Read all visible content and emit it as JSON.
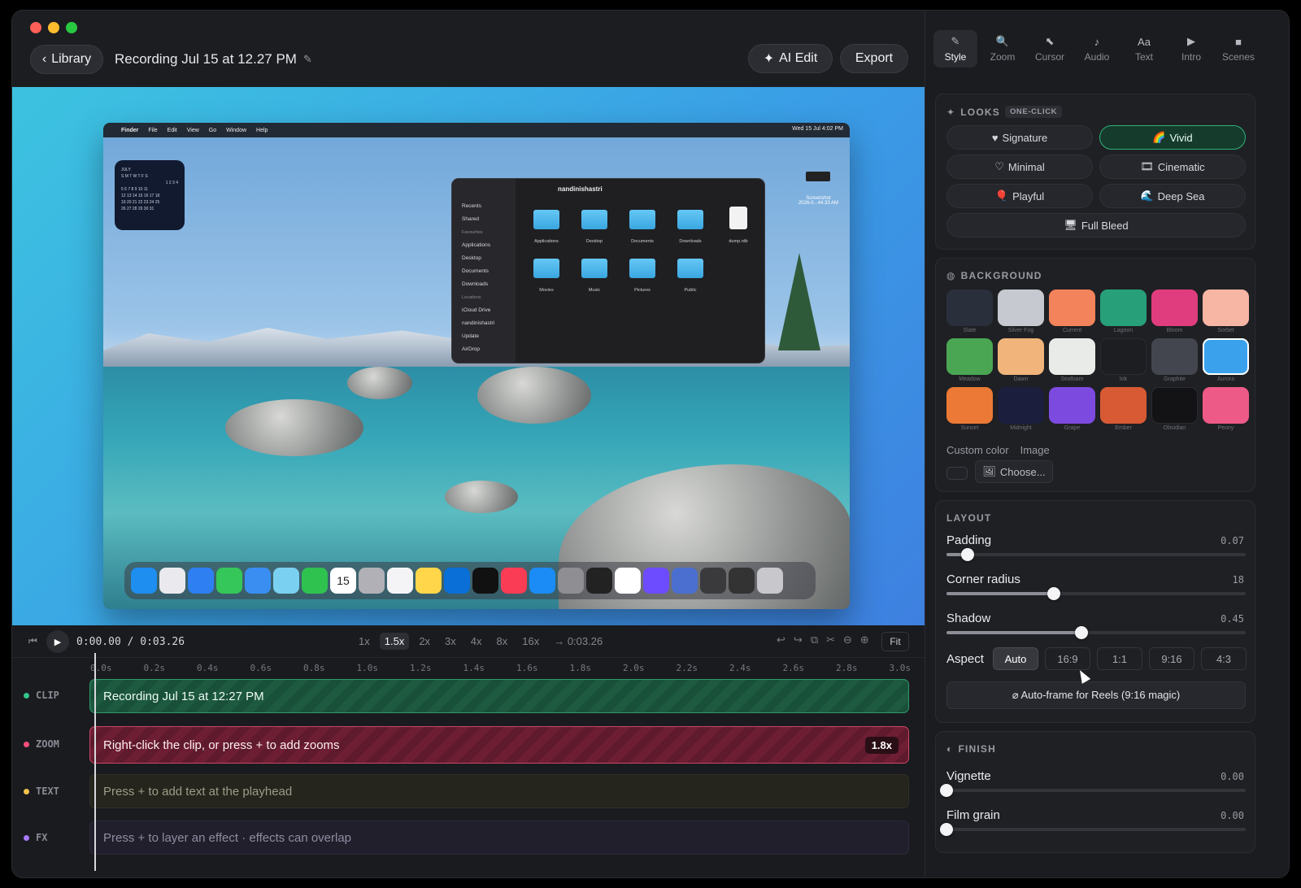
{
  "header": {
    "library_label": "Library",
    "recording_title": "Recording Jul 15 at 12.27 PM",
    "ai_edit_label": "AI Edit",
    "export_label": "Export"
  },
  "preview": {
    "menubar": {
      "app": "Finder",
      "menus": [
        "File",
        "Edit",
        "View",
        "Go",
        "Window",
        "Help"
      ],
      "clock": "Wed 15 Jul 4:02 PM"
    },
    "calendar": {
      "month": "JULY",
      "weekdays": "S M T W T F S",
      "rows": [
        "1 2 3 4",
        "5 6 7 8 9 10 11",
        "12 13 14 15 16 17 18",
        "19 20 21 22 23 24 25",
        "26 27 28 29 30 31"
      ]
    },
    "finder": {
      "title": "nandinishastri",
      "sidebar": [
        "Recents",
        "Shared",
        "Favourites",
        "Applications",
        "Desktop",
        "Documents",
        "Downloads",
        "Locations",
        "iCloud Drive",
        "nandinishastri",
        "Update",
        "AirDrop"
      ],
      "folders": [
        "Applications",
        "Desktop",
        "Documents",
        "Downloads",
        "dump.rdb",
        "Movies",
        "Music",
        "Pictures",
        "Public"
      ]
    },
    "screenshot_label": "Screenshot\n2026-0...44.33 AM",
    "dock_calendar_day": "15"
  },
  "transport": {
    "time": "0:00.00 / 0:03.26",
    "speeds": [
      "1x",
      "1.5x",
      "2x",
      "3x",
      "4x",
      "8x",
      "16x",
      "→ 0:03.26"
    ],
    "active_speed": "1.5x",
    "fit_label": "Fit"
  },
  "timeline": {
    "ticks": [
      "0.0s",
      "0.2s",
      "0.4s",
      "0.6s",
      "0.8s",
      "1.0s",
      "1.2s",
      "1.4s",
      "1.6s",
      "1.8s",
      "2.0s",
      "2.2s",
      "2.4s",
      "2.6s",
      "2.8s",
      "3.0s"
    ],
    "tracks": {
      "clip": {
        "label": "CLIP",
        "text": "Recording Jul 15 at 12:27 PM",
        "color": "#34c58a"
      },
      "zoom": {
        "label": "ZOOM",
        "text": "Right-click the clip, or press + to add zooms",
        "badge": "1.8x",
        "color": "#ff4f7b"
      },
      "text": {
        "label": "TEXT",
        "text": "Press + to add text at the playhead",
        "color": "#f2c34b"
      },
      "fx": {
        "label": "FX",
        "text": "Press + to layer an effect · effects can overlap",
        "color": "#a979ff"
      }
    }
  },
  "panel": {
    "tabs": [
      {
        "label": "Style",
        "icon": "brush-icon",
        "glyph": "✎"
      },
      {
        "label": "Zoom",
        "icon": "magnifier-icon",
        "glyph": "🔍"
      },
      {
        "label": "Cursor",
        "icon": "cursor-icon",
        "glyph": "⬉"
      },
      {
        "label": "Audio",
        "icon": "note-icon",
        "glyph": "♪"
      },
      {
        "label": "Text",
        "icon": "text-icon",
        "glyph": "Aa"
      },
      {
        "label": "Intro",
        "icon": "play-icon",
        "glyph": "▶"
      },
      {
        "label": "Scenes",
        "icon": "square-icon",
        "glyph": "■"
      }
    ],
    "looks": {
      "title": "LOOKS",
      "tag": "ONE-CLICK",
      "items": [
        {
          "label": "Signature",
          "glyph": "♥"
        },
        {
          "label": "Vivid",
          "glyph": "🌈"
        },
        {
          "label": "Minimal",
          "glyph": "♡"
        },
        {
          "label": "Cinematic",
          "glyph": "🎞"
        },
        {
          "label": "Playful",
          "glyph": "🎈"
        },
        {
          "label": "Deep Sea",
          "glyph": "🌊"
        },
        {
          "label": "Full Bleed",
          "glyph": "🖥"
        }
      ],
      "active": "Vivid"
    },
    "background": {
      "title": "BACKGROUND",
      "swatches": [
        {
          "name": "Slate",
          "color": "#2a2f3c"
        },
        {
          "name": "Silver Fog",
          "color": "#c6c9cf"
        },
        {
          "name": "Current",
          "color": "#f3835a"
        },
        {
          "name": "Lagoon",
          "color": "#27a07a"
        },
        {
          "name": "Bloom",
          "color": "#e03d7f"
        },
        {
          "name": "Sorbet",
          "color": "#f7b5a3"
        },
        {
          "name": "Meadow",
          "color": "#4aa653"
        },
        {
          "name": "Dawn",
          "color": "#f1b47a"
        },
        {
          "name": "Seafoam",
          "color": "#e8ebe7"
        },
        {
          "name": "Ink",
          "color": "#1d1e22"
        },
        {
          "name": "Graphite",
          "color": "#44464f"
        },
        {
          "name": "Aurora",
          "color": "#3aa2ec"
        },
        {
          "name": "Sunset",
          "color": "#ec7a36"
        },
        {
          "name": "Midnight",
          "color": "#1c1e3e"
        },
        {
          "name": "Grape",
          "color": "#7d4ae0"
        },
        {
          "name": "Ember",
          "color": "#d75a34"
        },
        {
          "name": "Obsidian",
          "color": "#131316"
        },
        {
          "name": "Peony",
          "color": "#ee5a88"
        }
      ],
      "selected": "Aurora",
      "custom_color_label": "Custom color",
      "image_label": "Image",
      "choose_label": "Choose..."
    },
    "layout": {
      "title": "LAYOUT",
      "padding": {
        "label": "Padding",
        "value": "0.07",
        "fraction": 0.07
      },
      "corner_radius": {
        "label": "Corner radius",
        "value": "18",
        "fraction": 0.36
      },
      "shadow": {
        "label": "Shadow",
        "value": "0.45",
        "fraction": 0.45
      },
      "aspect_label": "Aspect",
      "aspects": [
        "Auto",
        "16:9",
        "1:1",
        "9:16",
        "4:3"
      ],
      "active_aspect": "Auto",
      "autoframe_label": "⌀ Auto-frame for Reels (9:16 magic)"
    },
    "finish": {
      "title": "FINISH",
      "vignette": {
        "label": "Vignette",
        "value": "0.00",
        "fraction": 0
      },
      "film_grain": {
        "label": "Film grain",
        "value": "0.00",
        "fraction": 0
      }
    }
  }
}
